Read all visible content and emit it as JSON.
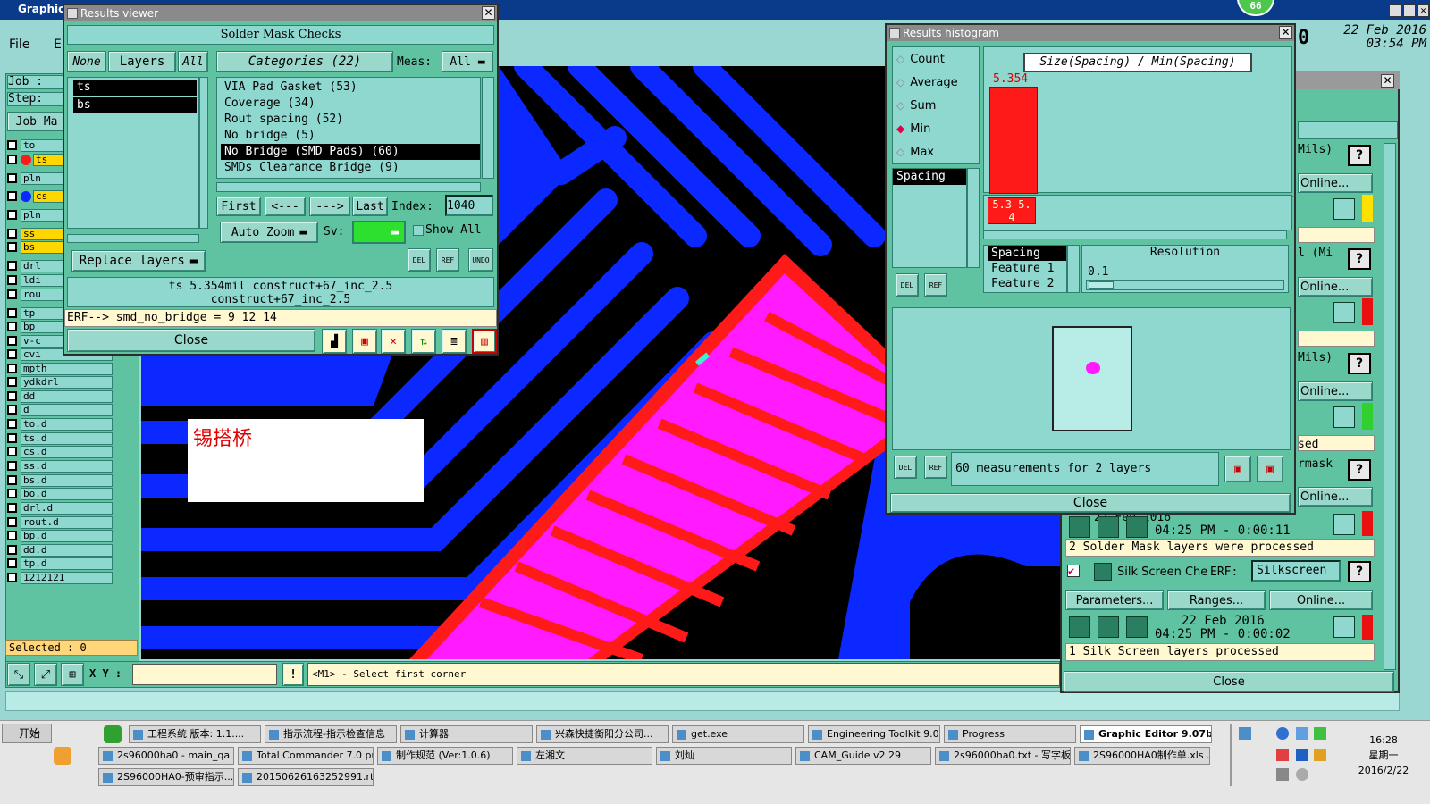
{
  "main": {
    "title": "Graphic",
    "file_menu": "File",
    "e_menu": "E",
    "job_label": "Job :",
    "step_label": "Step:",
    "job_ma": "Job Ma",
    "selected": "Selected : 0",
    "xy_label": "X Y :",
    "xy_value": "",
    "status_msg": "<M1> - Select first corner",
    "date": "22 Feb 2016",
    "time": "03:54 PM",
    "badge": "66",
    "zero": "0",
    "annotation": "锡搭桥"
  },
  "layers": [
    "to",
    "ts",
    "pln",
    "cs",
    "pln",
    "ss",
    "bs",
    "drl",
    "ldi",
    "rou",
    "tp",
    "bp",
    "v-c",
    "cvi",
    "mpth",
    "ydkdrl",
    "dd",
    "d",
    "to.d",
    "ts.d",
    "cs.d",
    "ss.d",
    "bs.d",
    "bo.d",
    "drl.d",
    "rout.d",
    "bp.d",
    "dd.d",
    "tp.d",
    "1212121"
  ],
  "results": {
    "window_title": "Results viewer",
    "section_title": "Solder Mask Checks",
    "none": "None",
    "layers_label": "Layers",
    "all": "All",
    "categories": "Categories (22)",
    "meas_label": "Meas:",
    "meas_value": "All",
    "layer_items": [
      "ts",
      "bs"
    ],
    "category_items": [
      "VIA Pad Gasket (53)",
      "Coverage (34)",
      "Rout spacing (52)",
      "No bridge (5)",
      "No Bridge (SMD Pads) (60)",
      "SMDs Clearance Bridge (9)"
    ],
    "first": "First",
    "prev": "<---",
    "next": "--->",
    "last": "Last",
    "index_label": "Index:",
    "index_value": "1040",
    "auto_zoom": "Auto Zoom",
    "sv_label": "Sv:",
    "show_all": "Show All",
    "replace_layers": "Replace layers",
    "info1": "ts 5.354mil  construct+67_inc_2.5",
    "info2": "construct+67_inc_2.5",
    "erf": "ERF--> smd_no_bridge = 9 12 14",
    "close": "Close",
    "del": "DEL",
    "ref": "REF",
    "undo": "UNDO"
  },
  "histogram": {
    "window_title": "Results histogram",
    "options": [
      "Count",
      "Average",
      "Sum",
      "Min",
      "Max"
    ],
    "selected_option": "Min",
    "attr_title": "Size(Spacing) / Min(Spacing)",
    "bar_value": "5.354",
    "bar_range": "5.3-5.4",
    "spacing": "Spacing",
    "list2": [
      "Spacing",
      "Feature 1",
      "Feature 2"
    ],
    "resolution_label": "Resolution",
    "resolution_value": "0.1",
    "measurements": "60 measurements for 2 layers",
    "close": "Close",
    "del": "DEL",
    "ref": "REF"
  },
  "right_panel": {
    "mils": "Mils)",
    "online": "Online...",
    "mi": "l (Mi",
    "sed": "sed",
    "rmask": "rmask",
    "timestamp1_date": "22 Feb 2016",
    "timestamp1_time": "04:25 PM - 0:00:11",
    "sm_processed": "2 Solder Mask layers were processed",
    "silk_label": "Silk Screen Che",
    "erf": "ERF:",
    "silk_value": "Silkscreen",
    "parameters": "Parameters...",
    "ranges": "Ranges...",
    "timestamp2_date": "22 Feb 2016",
    "timestamp2_time": "04:25 PM - 0:00:02",
    "silk_processed": "1 Silk Screen layers processed",
    "close": "Close",
    "q": "?",
    "warn": "!"
  },
  "taskbar": {
    "start": "开始",
    "clock_time": "16:28",
    "clock_day": "星期一",
    "clock_date": "2016/2/22",
    "row1": [
      "工程系统  版本: 1.1....",
      "指示流程-指示检查信息",
      "计算器",
      "兴森快捷衡阳分公司...",
      "get.exe",
      "Engineering Toolkit 9.0...",
      "Progress",
      "Graphic Editor 9.07b..."
    ],
    "row2": [
      "2s96000ha0 - main_qa",
      "Total Commander 7.0 pu...",
      "制作规范 (Ver:1.0.6)",
      "左湘文",
      "刘灿",
      "CAM_Guide v2.29",
      "2s96000ha0.txt - 写字板",
      "2S96000HA0制作单.xls ..."
    ],
    "row3": [
      "2S96000HA0-预审指示...",
      "20150626163252991.rtf..."
    ]
  },
  "colors": {
    "teal": "#8ed8d0",
    "window_green": "#5fc3a2",
    "copper_blue": "#0a28ff",
    "mask_magenta": "#ff1aff",
    "pad_red": "#ff1a1a"
  }
}
